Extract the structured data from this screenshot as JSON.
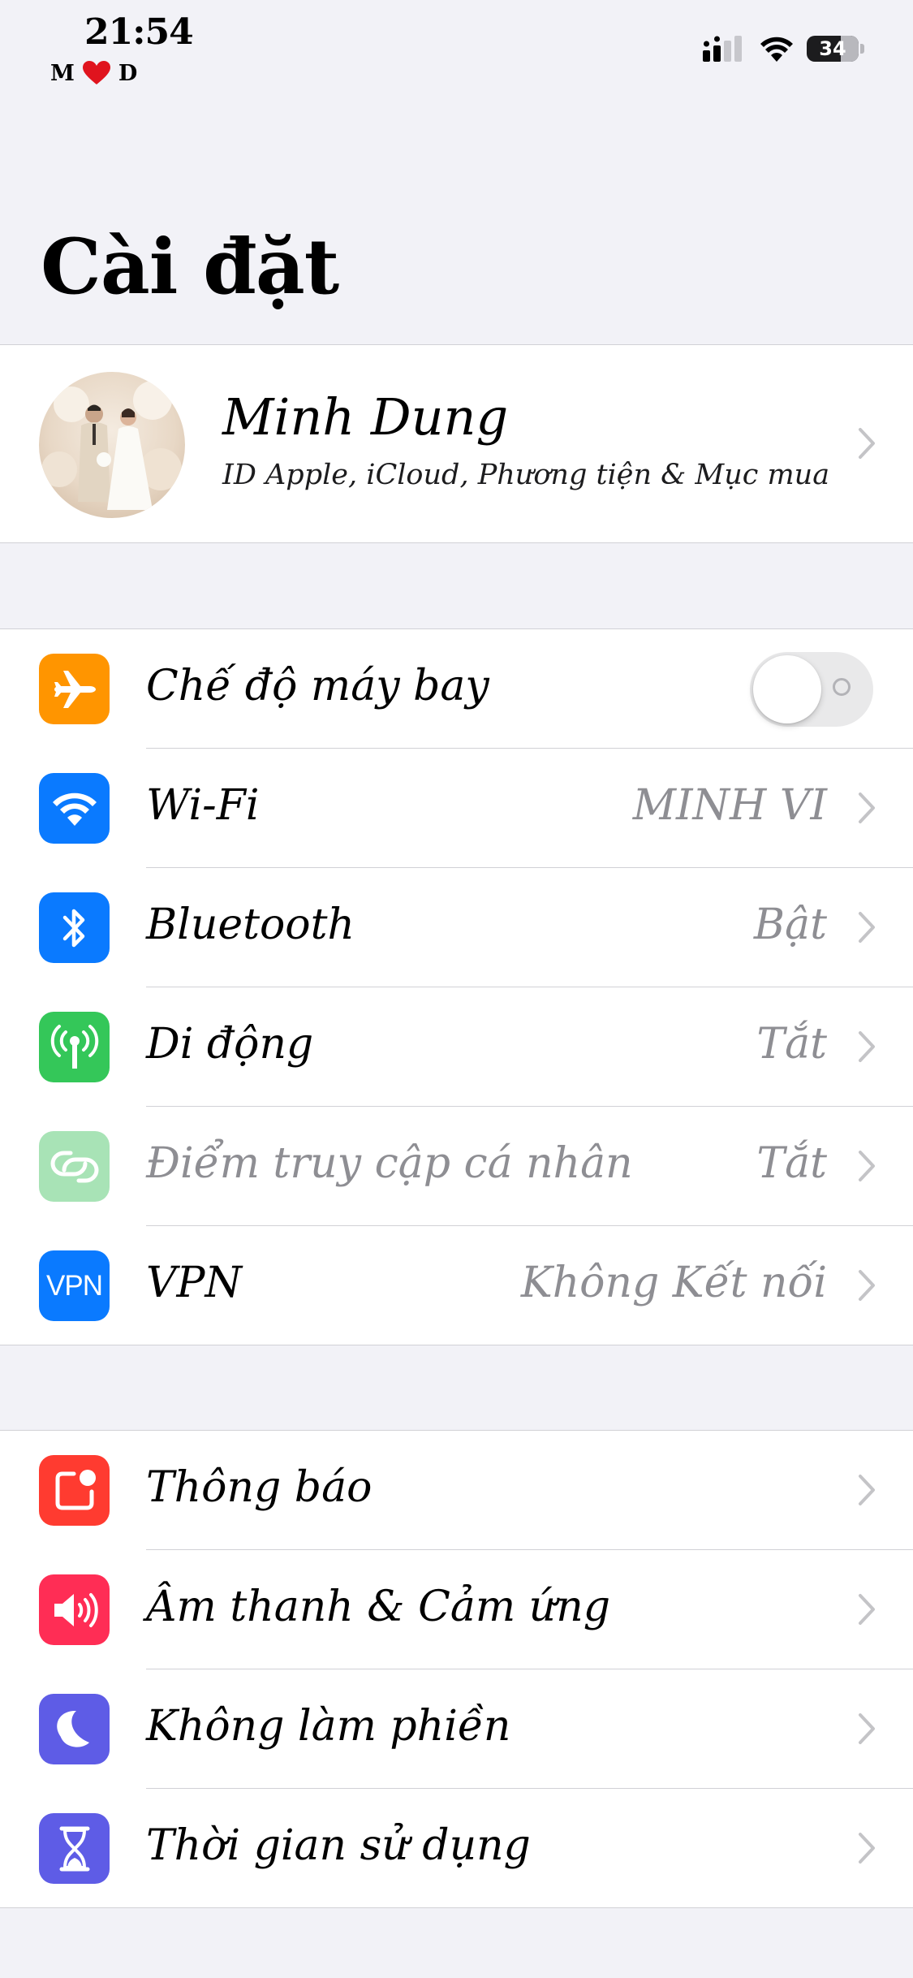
{
  "status_bar": {
    "time": "21:54",
    "carrier_left": "M",
    "carrier_right": "D",
    "battery_level": "34"
  },
  "title": "Cài đặt",
  "profile": {
    "name": "Minh Dung",
    "subtitle": "ID Apple, iCloud, Phương tiện & Mục mua"
  },
  "connectivity": [
    {
      "label": "Chế độ máy bay",
      "value": "",
      "icon": "airplane-icon",
      "color": "#ff9500",
      "toggle_on": false
    },
    {
      "label": "Wi-Fi",
      "value": "MINH VI",
      "icon": "wifi-icon",
      "color": "#0a7aff"
    },
    {
      "label": "Bluetooth",
      "value": "Bật",
      "icon": "bluetooth-icon",
      "color": "#0a7aff"
    },
    {
      "label": "Di động",
      "value": "Tắt",
      "icon": "cellular-antenna-icon",
      "color": "#34c759"
    },
    {
      "label": "Điểm truy cập cá nhân",
      "value": "Tắt",
      "icon": "hotspot-link-icon",
      "color": "#a8e3b6",
      "disabled": true
    },
    {
      "label": "VPN",
      "value": "Không Kết nối",
      "icon": "vpn-icon",
      "icon_text": "VPN",
      "color": "#0a7aff"
    }
  ],
  "notifications": [
    {
      "label": "Thông báo",
      "icon": "notification-badge-icon",
      "color": "#ff3b30"
    },
    {
      "label": "Âm thanh & Cảm ứng",
      "icon": "speaker-icon",
      "color": "#ff2d55"
    },
    {
      "label": "Không làm phiền",
      "icon": "moon-icon",
      "color": "#5e5ce6"
    },
    {
      "label": "Thời gian sử dụng",
      "icon": "hourglass-icon",
      "color": "#5e5ce6"
    }
  ]
}
